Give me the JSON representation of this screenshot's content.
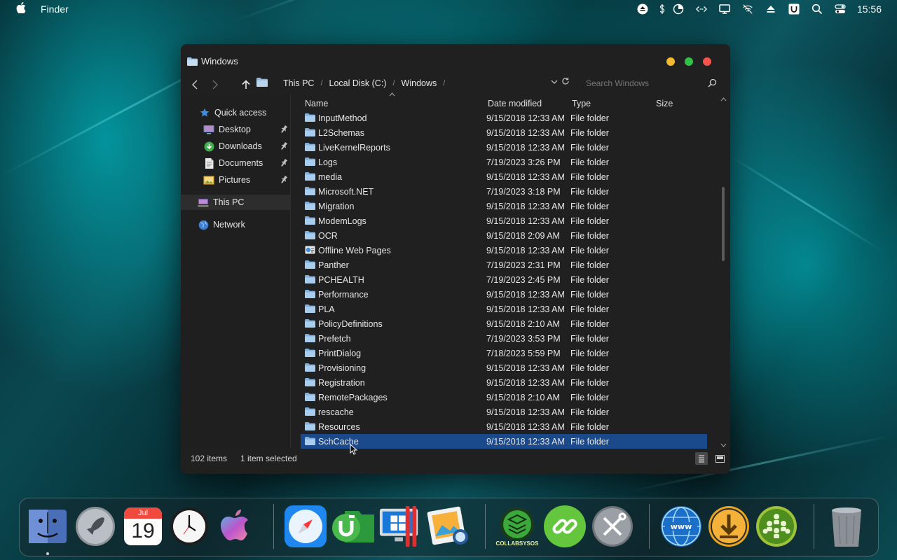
{
  "menubar": {
    "app_name": "Finder",
    "clock": "15:56"
  },
  "window": {
    "title": "Windows",
    "breadcrumbs": [
      "This PC",
      "Local Disk (C:)",
      "Windows"
    ],
    "search_placeholder": "Search Windows",
    "columns": {
      "name": "Name",
      "date": "Date modified",
      "type": "Type",
      "size": "Size"
    },
    "sidebar": {
      "quick_access": "Quick access",
      "pinned": [
        "Desktop",
        "Downloads",
        "Documents",
        "Pictures"
      ],
      "this_pc": "This PC",
      "network": "Network"
    },
    "rows": [
      {
        "name": "InputMethod",
        "date": "9/15/2018 12:33 AM",
        "type": "File folder"
      },
      {
        "name": "L2Schemas",
        "date": "9/15/2018 12:33 AM",
        "type": "File folder"
      },
      {
        "name": "LiveKernelReports",
        "date": "9/15/2018 12:33 AM",
        "type": "File folder"
      },
      {
        "name": "Logs",
        "date": "7/19/2023 3:26 PM",
        "type": "File folder"
      },
      {
        "name": "media",
        "date": "9/15/2018 12:33 AM",
        "type": "File folder"
      },
      {
        "name": "Microsoft.NET",
        "date": "7/19/2023 3:18 PM",
        "type": "File folder"
      },
      {
        "name": "Migration",
        "date": "9/15/2018 12:33 AM",
        "type": "File folder"
      },
      {
        "name": "ModemLogs",
        "date": "9/15/2018 12:33 AM",
        "type": "File folder"
      },
      {
        "name": "OCR",
        "date": "9/15/2018 2:09 AM",
        "type": "File folder"
      },
      {
        "name": "Offline Web Pages",
        "date": "9/15/2018 12:33 AM",
        "type": "File folder"
      },
      {
        "name": "Panther",
        "date": "7/19/2023 2:31 PM",
        "type": "File folder"
      },
      {
        "name": "PCHEALTH",
        "date": "7/19/2023 2:45 PM",
        "type": "File folder"
      },
      {
        "name": "Performance",
        "date": "9/15/2018 12:33 AM",
        "type": "File folder"
      },
      {
        "name": "PLA",
        "date": "9/15/2018 12:33 AM",
        "type": "File folder"
      },
      {
        "name": "PolicyDefinitions",
        "date": "9/15/2018 2:10 AM",
        "type": "File folder"
      },
      {
        "name": "Prefetch",
        "date": "7/19/2023 3:53 PM",
        "type": "File folder"
      },
      {
        "name": "PrintDialog",
        "date": "7/18/2023 5:59 PM",
        "type": "File folder"
      },
      {
        "name": "Provisioning",
        "date": "9/15/2018 12:33 AM",
        "type": "File folder"
      },
      {
        "name": "Registration",
        "date": "9/15/2018 12:33 AM",
        "type": "File folder"
      },
      {
        "name": "RemotePackages",
        "date": "9/15/2018 2:10 AM",
        "type": "File folder"
      },
      {
        "name": "rescache",
        "date": "9/15/2018 12:33 AM",
        "type": "File folder"
      },
      {
        "name": "Resources",
        "date": "9/15/2018 12:33 AM",
        "type": "File folder"
      },
      {
        "name": "SchCache",
        "date": "9/15/2018 12:33 AM",
        "type": "File folder"
      }
    ],
    "selected_index": 22,
    "status": {
      "count": "102 items",
      "selected": "1 item selected"
    }
  },
  "dock": {
    "calendar_month": "Jul",
    "calendar_day": "19",
    "collabsysos_label": "COLLABSYSOS",
    "www_label": "www"
  },
  "colors": {
    "window_bg": "#202020",
    "selection": "#1b4a8c",
    "traffic_yellow": "#f5b82e",
    "traffic_green": "#32c048",
    "traffic_red": "#f5544d"
  }
}
